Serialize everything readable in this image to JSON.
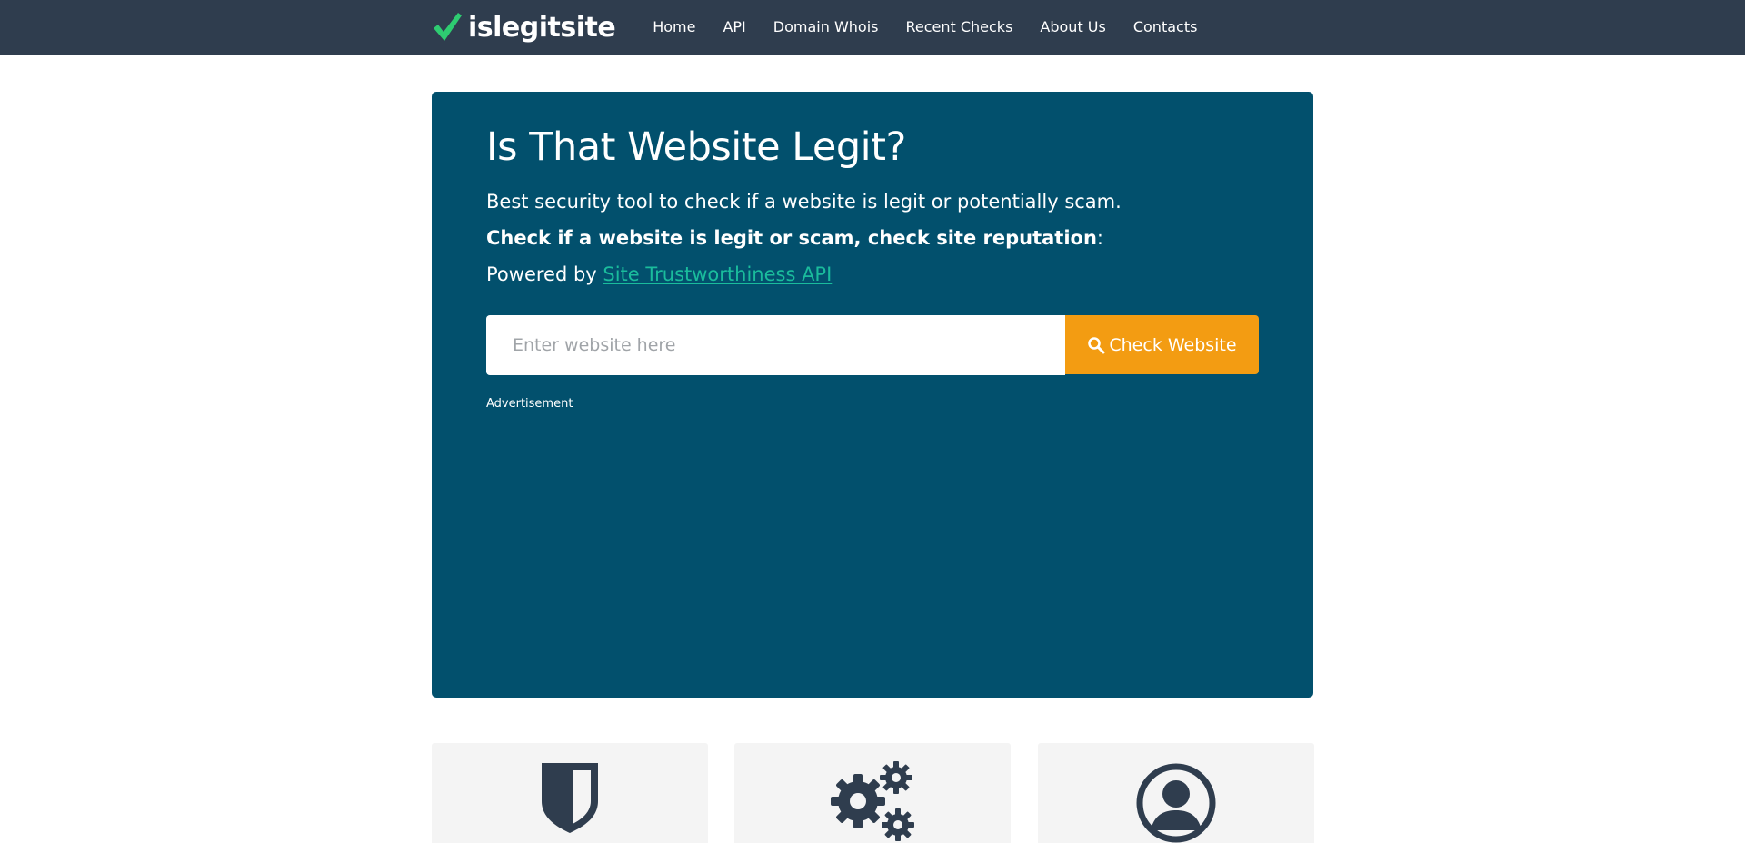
{
  "colors": {
    "navbar_bg": "#2f3d4e",
    "hero_bg": "#02506d",
    "accent_green": "#1abc9c",
    "check_green": "#2ecc71",
    "button_orange": "#f39c12",
    "card_bg": "#f4f4f4",
    "icon_dark": "#2f3d4e"
  },
  "navbar": {
    "brand": "islegitsite",
    "brand_icon": "checkmark-icon",
    "links": [
      "Home",
      "API",
      "Domain Whois",
      "Recent Checks",
      "About Us",
      "Contacts"
    ]
  },
  "hero": {
    "title": "Is That Website Legit?",
    "subtitle": "Best security tool to check if a website is legit or potentially scam.",
    "tagline_bold": "Check if a website is legit or scam, check site reputation",
    "tagline_suffix": ":",
    "powered_prefix": "Powered by ",
    "powered_link": "Site Trustworthiness API",
    "search": {
      "value": "",
      "placeholder": "Enter website here",
      "button_label": "Check Website",
      "button_icon": "search-icon"
    },
    "ad_label": "Advertisement"
  },
  "features": [
    {
      "icon": "shield-icon"
    },
    {
      "icon": "gears-icon"
    },
    {
      "icon": "user-circle-icon"
    }
  ]
}
